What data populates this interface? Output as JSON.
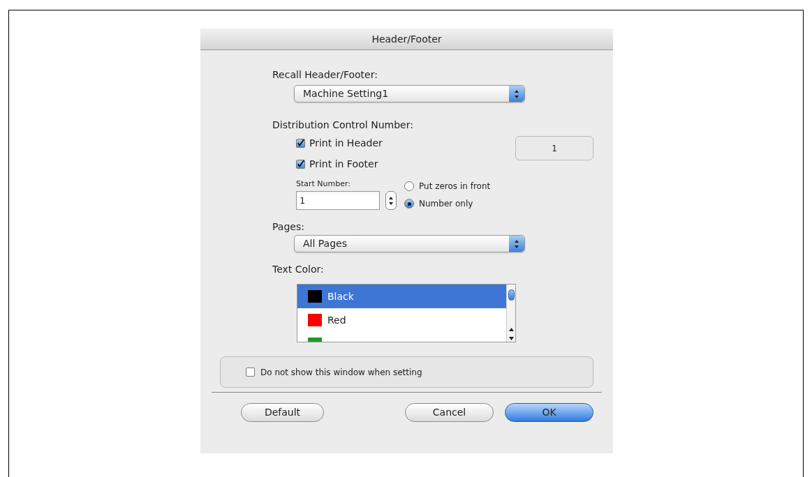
{
  "window": {
    "title": "Header/Footer"
  },
  "recall": {
    "label": "Recall Header/Footer:",
    "value": "Machine Setting1"
  },
  "distribution": {
    "label": "Distribution Control Number:",
    "checkboxes": [
      {
        "label": "Print in Header",
        "checked": true
      },
      {
        "label": "Print in Footer",
        "checked": true
      }
    ],
    "display_value": "1",
    "start_number": {
      "label": "Start Number:",
      "value": "1"
    },
    "radios": [
      {
        "label": "Put zeros in front",
        "selected": false
      },
      {
        "label": "Number only",
        "selected": true
      }
    ]
  },
  "pages": {
    "label": "Pages:",
    "value": "All Pages"
  },
  "text_color": {
    "label": "Text Color:",
    "items": [
      {
        "label": "Black",
        "color": "#000000",
        "selected": true
      },
      {
        "label": "Red",
        "color": "#ff0000",
        "selected": false
      },
      {
        "color": "#1a9a2a",
        "selected": false
      }
    ]
  },
  "dont_show": {
    "label": "Do not show this window when setting",
    "checked": false
  },
  "buttons": [
    {
      "label": "Default",
      "kind": "plain"
    },
    {
      "label": "Cancel",
      "kind": "plain"
    },
    {
      "label": "OK",
      "kind": "default"
    }
  ]
}
